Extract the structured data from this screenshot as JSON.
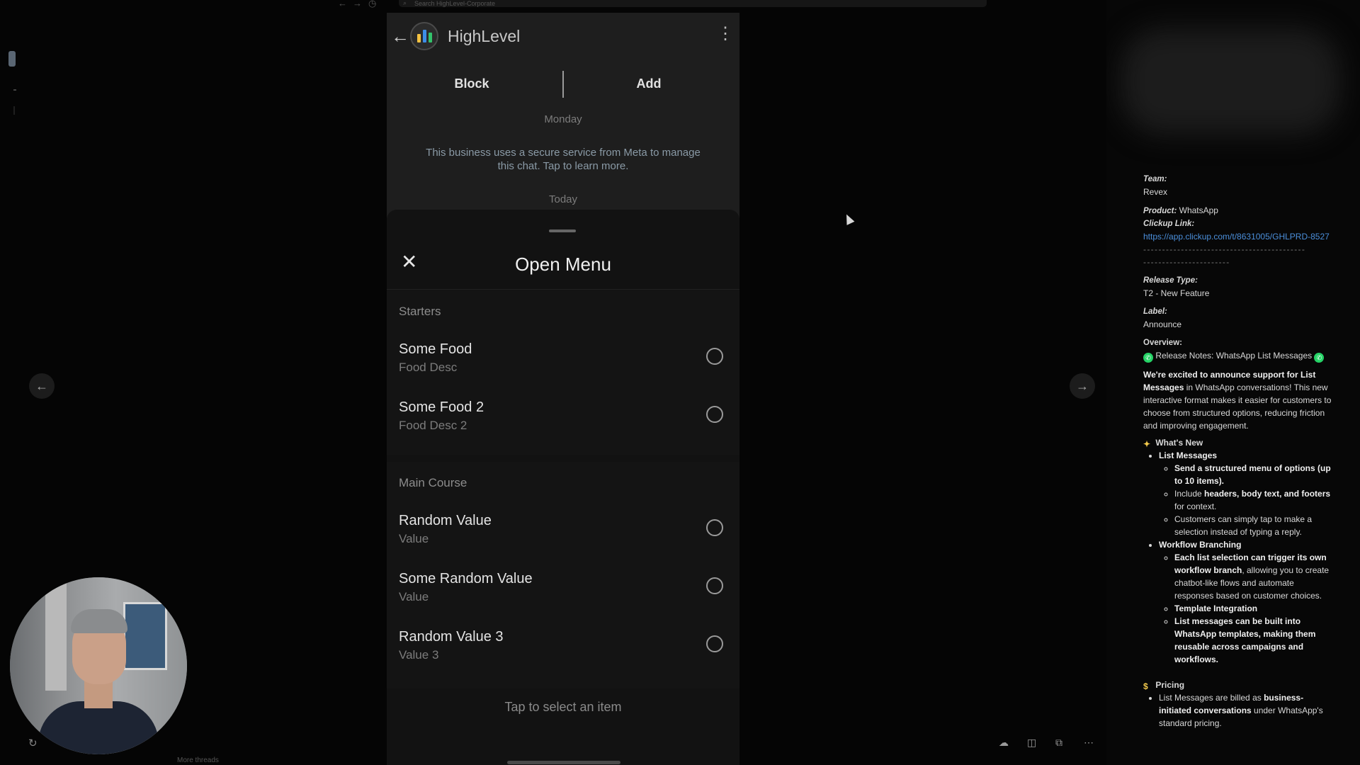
{
  "browser": {
    "search_placeholder": "Search HighLevel-Corporate"
  },
  "phone": {
    "app_title": "HighLevel",
    "actions": {
      "block": "Block",
      "add": "Add"
    },
    "day_label": "Monday",
    "meta_notice": "This business uses a secure service from Meta to manage this chat. Tap to learn more.",
    "today_label": "Today"
  },
  "menu": {
    "title": "Open Menu",
    "sections": [
      {
        "title": "Starters",
        "items": [
          {
            "name": "Some Food",
            "desc": "Food Desc"
          },
          {
            "name": "Some Food 2",
            "desc": "Food Desc 2"
          }
        ]
      },
      {
        "title": "Main Course",
        "items": [
          {
            "name": "Random Value",
            "desc": "Value"
          },
          {
            "name": "Some Random Value",
            "desc": "Value"
          },
          {
            "name": "Random Value 3",
            "desc": "Value 3"
          }
        ]
      }
    ],
    "footer_hint": "Tap to select an item"
  },
  "notes": {
    "team_label": "Team:",
    "team": "Revex",
    "product_label": "Product:",
    "product": "WhatsApp",
    "clickup_label": "Clickup Link:",
    "clickup_url": "https://app.clickup.com/t/8631005/GHLPRD-8527",
    "release_type_label": "Release Type:",
    "release_type": "T2 - New Feature",
    "label_label": "Label:",
    "label": "Announce",
    "overview_label": "Overview:",
    "release_title": "Release Notes: WhatsApp List Messages",
    "intro_bold": "We're excited to announce support for List Messages",
    "intro_rest": " in WhatsApp conversations! This new interactive format makes it easier for customers to choose from structured options, reducing friction and improving engagement.",
    "whats_new": "What's New",
    "list_messages": "List Messages",
    "lm_1": "Send a structured menu of options (up to 10 items).",
    "lm_2a": "Include ",
    "lm_2b": "headers, body text, and footers",
    "lm_2c": " for context.",
    "lm_3": "Customers can simply tap to make a selection instead of typing a reply.",
    "workflow_branching": "Workflow Branching",
    "wb_1a": "Each list selection can trigger its own workflow branch",
    "wb_1b": ", allowing you to create chatbot-like flows and automate responses based on customer choices.",
    "wb_2": "Template Integration",
    "wb_3": "List messages can be built into WhatsApp templates, making them reusable across campaigns and workflows.",
    "pricing": "Pricing",
    "pr_1a": "List Messages are billed as ",
    "pr_1b": "business-initiated conversations",
    "pr_1c": " under WhatsApp's standard pricing."
  },
  "footer": {
    "more_threads": "More threads"
  }
}
